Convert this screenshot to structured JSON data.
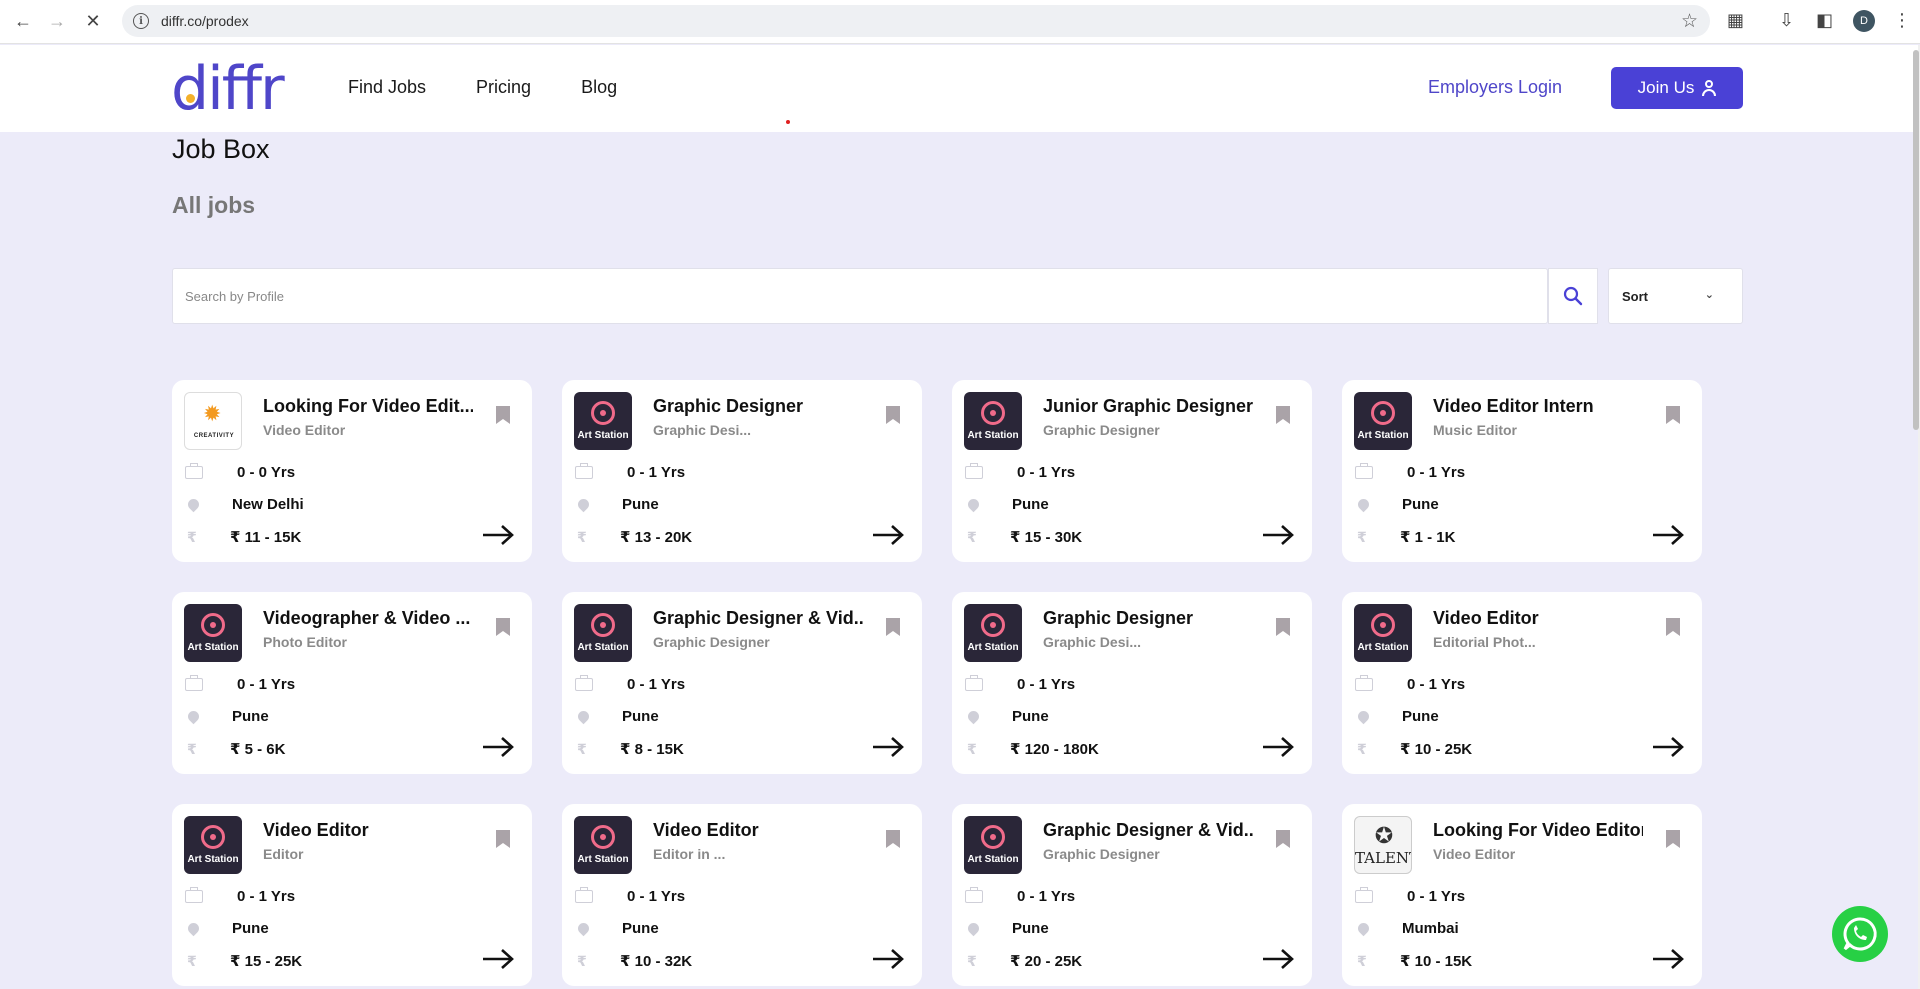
{
  "browser": {
    "url": "diffr.co/prodex",
    "profile_initial": "D"
  },
  "site": {
    "logo": "diffr",
    "nav": [
      "Find Jobs",
      "Pricing",
      "Blog"
    ],
    "employers_login": "Employers Login",
    "join_label": "Join Us"
  },
  "page": {
    "title": "Job Box",
    "subtitle": "All jobs",
    "search_placeholder": "Search by Profile",
    "sort_label": "Sort"
  },
  "jobs": [
    {
      "logo": "creativity",
      "logo_text": "CREATIVITY",
      "title": "Looking For Video Edit...",
      "category": "Video Editor",
      "experience": "0 - 0 Yrs",
      "location": "New Delhi",
      "salary": "₹ 11 - 15K"
    },
    {
      "logo": "artstation",
      "logo_text": "Art Station",
      "title": "Graphic Designer",
      "category": "Graphic Desi...",
      "experience": "0 - 1 Yrs",
      "location": "Pune",
      "salary": "₹ 13 - 20K"
    },
    {
      "logo": "artstation",
      "logo_text": "Art Station",
      "title": "Junior Graphic Designer",
      "category": "Graphic Designer",
      "experience": "0 - 1 Yrs",
      "location": "Pune",
      "salary": "₹ 15 - 30K"
    },
    {
      "logo": "artstation",
      "logo_text": "Art Station",
      "title": "Video Editor Intern",
      "category": "Music Editor",
      "experience": "0 - 1 Yrs",
      "location": "Pune",
      "salary": "₹ 1 - 1K"
    },
    {
      "logo": "artstation",
      "logo_text": "Art Station",
      "title": "Videographer & Video ...",
      "category": "Photo Editor",
      "experience": "0 - 1 Yrs",
      "location": "Pune",
      "salary": "₹ 5 - 6K"
    },
    {
      "logo": "artstation",
      "logo_text": "Art Station",
      "title": "Graphic Designer & Vid...",
      "category": "Graphic Designer",
      "experience": "0 - 1 Yrs",
      "location": "Pune",
      "salary": "₹ 8 - 15K"
    },
    {
      "logo": "artstation",
      "logo_text": "Art Station",
      "title": "Graphic Designer",
      "category": "Graphic Desi...",
      "experience": "0 - 1 Yrs",
      "location": "Pune",
      "salary": "₹ 120 - 180K"
    },
    {
      "logo": "artstation",
      "logo_text": "Art Station",
      "title": "Video Editor",
      "category": "Editorial Phot...",
      "experience": "0 - 1 Yrs",
      "location": "Pune",
      "salary": "₹ 10 - 25K"
    },
    {
      "logo": "artstation",
      "logo_text": "Art Station",
      "title": "Video Editor",
      "category": "Editor",
      "experience": "0 - 1 Yrs",
      "location": "Pune",
      "salary": "₹ 15 - 25K"
    },
    {
      "logo": "artstation",
      "logo_text": "Art Station",
      "title": "Video Editor",
      "category": "Editor in ...",
      "experience": "0 - 1 Yrs",
      "location": "Pune",
      "salary": "₹ 10 - 32K"
    },
    {
      "logo": "artstation",
      "logo_text": "Art Station",
      "title": "Graphic Designer & Vid...",
      "category": "Graphic Designer",
      "experience": "0 - 1 Yrs",
      "location": "Pune",
      "salary": "₹ 20 - 25K"
    },
    {
      "logo": "talent",
      "logo_text": "TALENT",
      "title": "Looking For Video Editor",
      "category": "Video Editor",
      "experience": "0 - 1 Yrs",
      "location": "Mumbai",
      "salary": "₹ 10 - 15K"
    }
  ],
  "colors": {
    "brand": "#4f46c9",
    "page_bg": "#ecebf9",
    "join_button": "#4a41d6",
    "whatsapp": "#27d045"
  }
}
